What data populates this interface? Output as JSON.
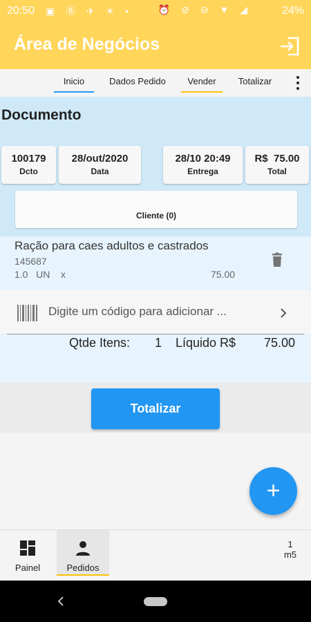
{
  "status_bar": {
    "time": "20:50",
    "battery": "24%"
  },
  "app_bar": {
    "title": "Área de Negócios"
  },
  "tabs": [
    {
      "label": "Inicio",
      "underline": "#2196f3"
    },
    {
      "label": "Dados Pedido"
    },
    {
      "label": "Vender",
      "underline": "#ffc107"
    },
    {
      "label": "Totalizar"
    }
  ],
  "document": {
    "title": "Documento",
    "fields": [
      {
        "value": "100179",
        "label": "Dcto"
      },
      {
        "value": "28/out/2020",
        "label": "Data"
      },
      {
        "value": "28/10 20:49",
        "label": "Entrega"
      },
      {
        "value": "R$  75.00",
        "label": "Total"
      }
    ],
    "cliente": "Cliente (0)"
  },
  "item": {
    "name": "Ração para caes adultos e castrados",
    "code": "145687",
    "qty": "1.0   UN    x",
    "price": "75.00"
  },
  "search": {
    "placeholder": "Digite um código para adicionar ..."
  },
  "totals": {
    "qtde_label": "Qtde Itens:",
    "qtde_value": "1",
    "liquido_label": "Líquido R$",
    "liquido_value": "75.00"
  },
  "totalizar_button": "Totalizar",
  "fab_symbol": "+",
  "bottom_nav": {
    "items": [
      {
        "label": "Painel"
      },
      {
        "label": "Pedidos"
      }
    ],
    "counter_top": "1",
    "counter_bottom": "m5"
  },
  "colors": {
    "app_bar": "#ffd55a",
    "accent_blue": "#2196f3",
    "accent_yellow": "#ffc107",
    "info_bg": "#cfe9f9"
  }
}
